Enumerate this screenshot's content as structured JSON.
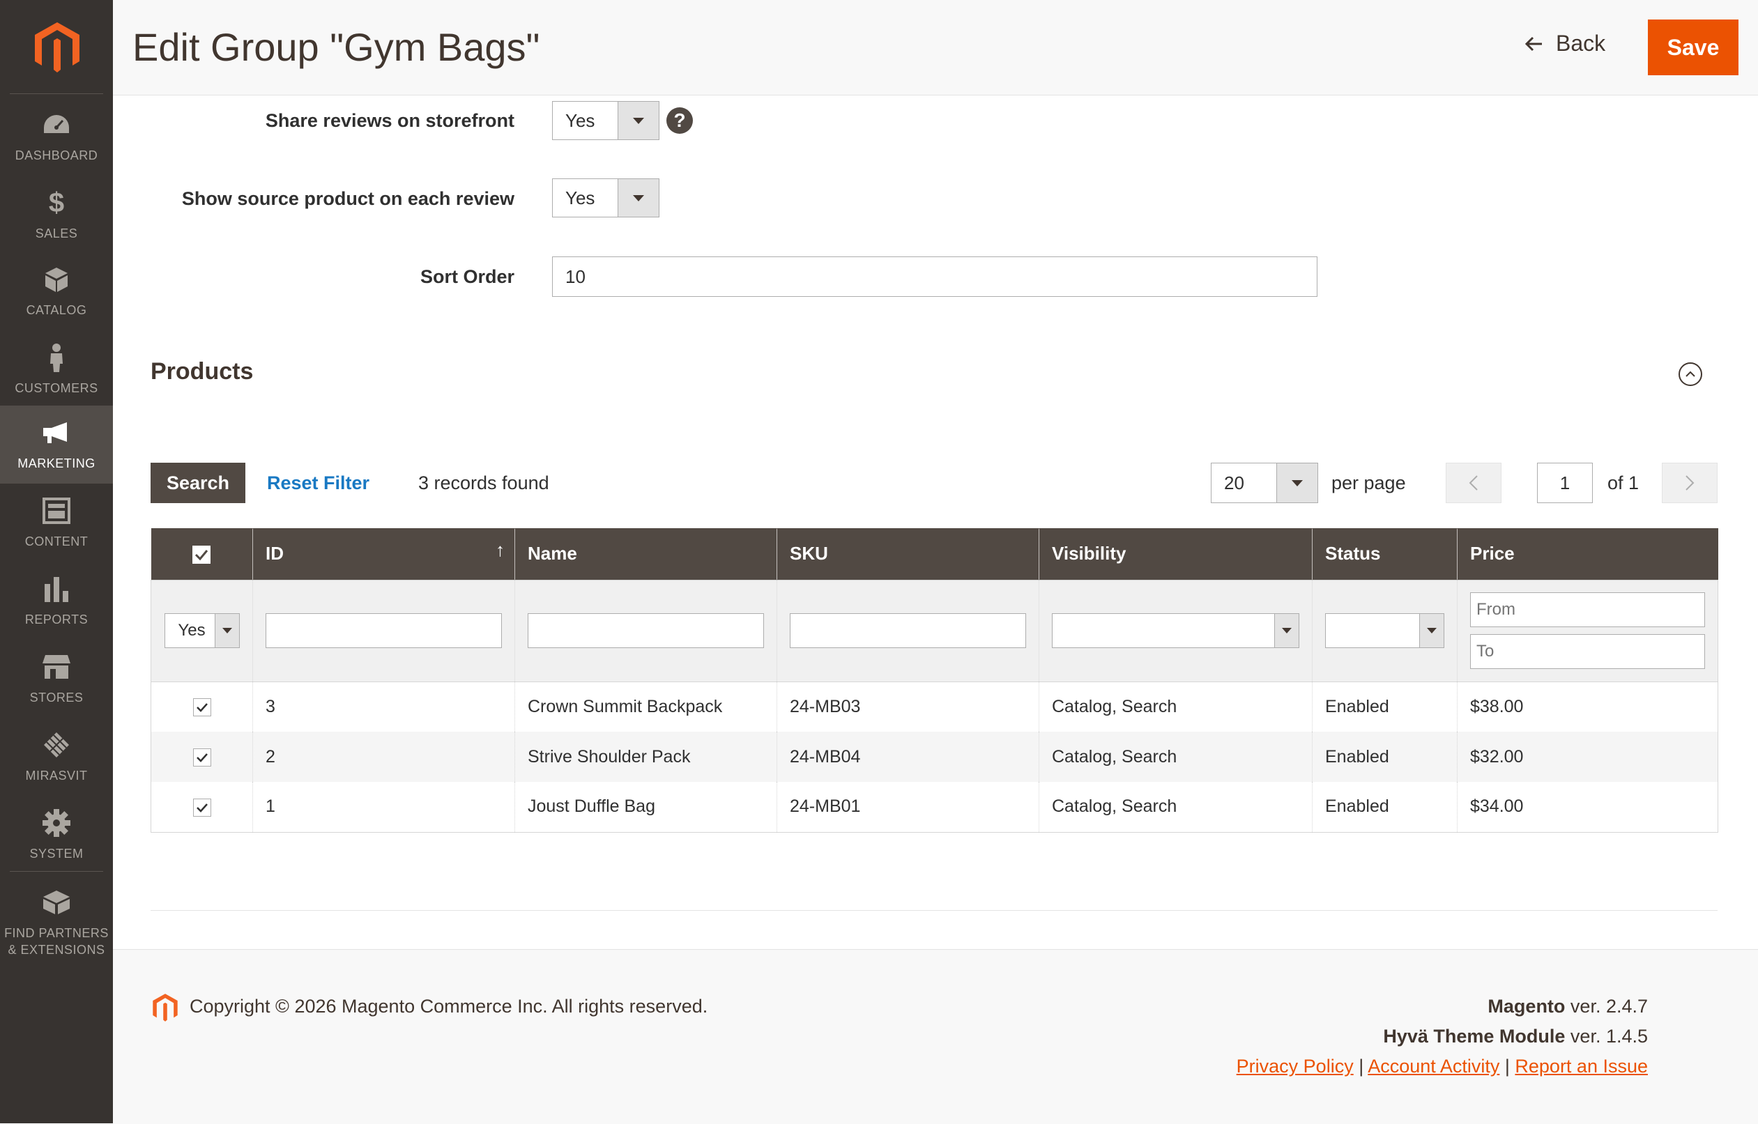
{
  "colors": {
    "accent": "#eb5202",
    "sidebar": "#373330",
    "link": "#1979c3",
    "grid_header": "#514943"
  },
  "sidebar": {
    "items": [
      {
        "label": "DASHBOARD",
        "icon": "speedometer-icon"
      },
      {
        "label": "SALES",
        "icon": "dollar-icon"
      },
      {
        "label": "CATALOG",
        "icon": "box-icon"
      },
      {
        "label": "CUSTOMERS",
        "icon": "person-icon"
      },
      {
        "label": "MARKETING",
        "icon": "megaphone-icon",
        "active": true
      },
      {
        "label": "CONTENT",
        "icon": "layout-icon"
      },
      {
        "label": "REPORTS",
        "icon": "bar-chart-icon"
      },
      {
        "label": "STORES",
        "icon": "storefront-icon"
      },
      {
        "label": "MIRASVIT",
        "icon": "mirasvit-icon"
      },
      {
        "label": "SYSTEM",
        "icon": "gear-icon"
      },
      {
        "label_line1": "FIND PARTNERS",
        "label_line2": "& EXTENSIONS",
        "icon": "blocks-icon"
      }
    ]
  },
  "header": {
    "title": "Edit Group \"Gym Bags\"",
    "back_label": "Back",
    "save_label": "Save"
  },
  "form": {
    "share_reviews": {
      "label": "Share reviews on storefront",
      "value": "Yes"
    },
    "show_source": {
      "label": "Show source product on each review",
      "value": "Yes"
    },
    "sort_order": {
      "label": "Sort Order",
      "value": "10"
    },
    "help": "?"
  },
  "products": {
    "title": "Products",
    "search_label": "Search",
    "reset_label": "Reset Filter",
    "records_found": "3 records found",
    "per_page_value": "20",
    "per_page_label": "per page",
    "page_current": "1",
    "page_total": "of 1",
    "columns": [
      "ID",
      "Name",
      "SKU",
      "Visibility",
      "Status",
      "Price"
    ],
    "filters": {
      "in_group": "Yes",
      "price_from_placeholder": "From",
      "price_to_placeholder": "To"
    },
    "rows": [
      {
        "id": "3",
        "name": "Crown Summit Backpack",
        "sku": "24-MB03",
        "visibility": "Catalog, Search",
        "status": "Enabled",
        "price": "$38.00"
      },
      {
        "id": "2",
        "name": "Strive Shoulder Pack",
        "sku": "24-MB04",
        "visibility": "Catalog, Search",
        "status": "Enabled",
        "price": "$32.00"
      },
      {
        "id": "1",
        "name": "Joust Duffle Bag",
        "sku": "24-MB01",
        "visibility": "Catalog, Search",
        "status": "Enabled",
        "price": "$34.00"
      }
    ]
  },
  "footer": {
    "copyright": "Copyright © 2026 Magento Commerce Inc. All rights reserved.",
    "magento_name": "Magento",
    "magento_ver": " ver. 2.4.7",
    "hyva_name": "Hyvä Theme Module",
    "hyva_ver": " ver. 1.4.5",
    "privacy": "Privacy Policy",
    "account": " Account Activity",
    "report": "Report an Issue",
    "separator": "|"
  }
}
